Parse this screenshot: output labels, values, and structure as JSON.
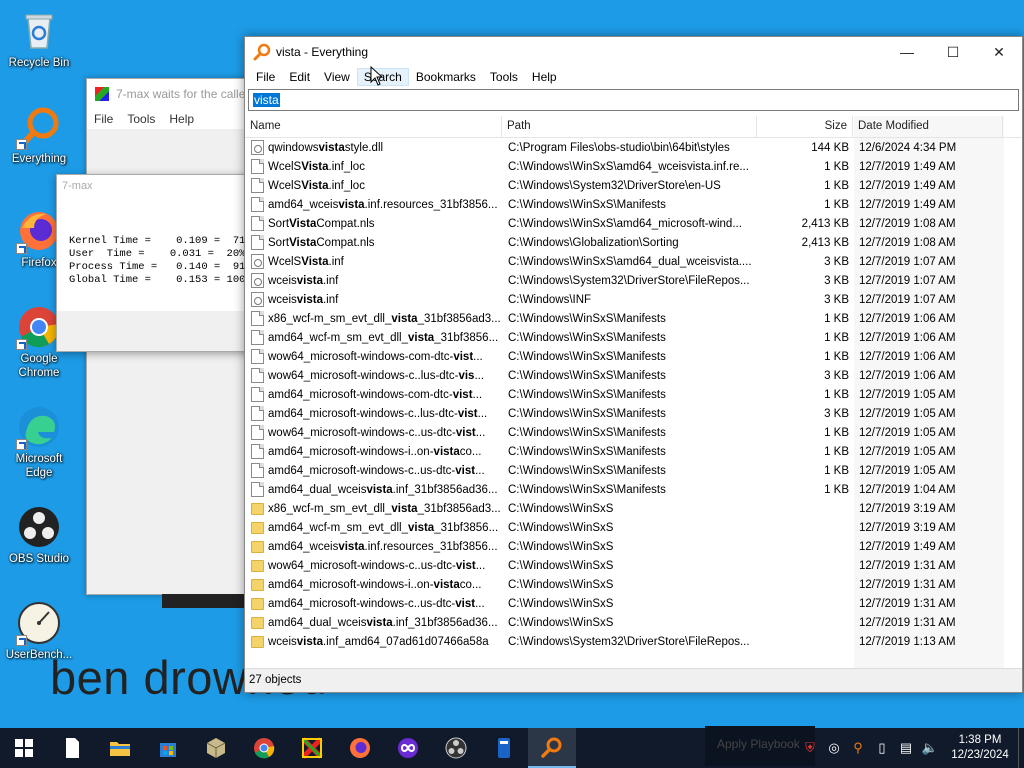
{
  "desktop": {
    "icons": [
      {
        "label": "Recycle Bin"
      },
      {
        "label": "Everything"
      },
      {
        "label": "Firefox"
      },
      {
        "label": "Google Chrome"
      },
      {
        "label": "Microsoft Edge"
      },
      {
        "label": "OBS Studio"
      },
      {
        "label": "UserBench..."
      }
    ],
    "wallpaper_text": "ben drowned"
  },
  "sevenmax_window": {
    "title": "7-max waits for the calle",
    "menu": [
      "File",
      "Tools",
      "Help"
    ]
  },
  "sevenmax_popup": {
    "title": "7-max",
    "stats": "Kernel Time =    0.109 =  71%   C\nUser  Time =    0.031 =  20%\nProcess Time =   0.140 =  91%   V\nGlobal Time =    0.153 = 100%   F"
  },
  "everything": {
    "title": "vista - Everything",
    "menu": [
      "File",
      "Edit",
      "View",
      "Search",
      "Bookmarks",
      "Tools",
      "Help"
    ],
    "search_value": "vista",
    "columns": {
      "name": "Name",
      "path": "Path",
      "size": "Size",
      "date": "Date Modified"
    },
    "rows": [
      {
        "icon": "gear",
        "pre": "qwindows",
        "bold": "vista",
        "post": "style.dll",
        "path": "C:\\Program Files\\obs-studio\\bin\\64bit\\styles",
        "size": "144 KB",
        "date": "12/6/2024 4:34 PM"
      },
      {
        "icon": "file",
        "pre": "WcelS",
        "bold": "Vista",
        "post": ".inf_loc",
        "path": "C:\\Windows\\WinSxS\\amd64_wceisvista.inf.re...",
        "size": "1 KB",
        "date": "12/7/2019 1:49 AM"
      },
      {
        "icon": "file",
        "pre": "WcelS",
        "bold": "Vista",
        "post": ".inf_loc",
        "path": "C:\\Windows\\System32\\DriverStore\\en-US",
        "size": "1 KB",
        "date": "12/7/2019 1:49 AM"
      },
      {
        "icon": "file",
        "pre": "amd64_wceis",
        "bold": "vista",
        "post": ".inf.resources_31bf3856...",
        "path": "C:\\Windows\\WinSxS\\Manifests",
        "size": "1 KB",
        "date": "12/7/2019 1:49 AM"
      },
      {
        "icon": "file",
        "pre": "Sort",
        "bold": "Vista",
        "post": "Compat.nls",
        "path": "C:\\Windows\\WinSxS\\amd64_microsoft-wind...",
        "size": "2,413 KB",
        "date": "12/7/2019 1:08 AM"
      },
      {
        "icon": "file",
        "pre": "Sort",
        "bold": "Vista",
        "post": "Compat.nls",
        "path": "C:\\Windows\\Globalization\\Sorting",
        "size": "2,413 KB",
        "date": "12/7/2019 1:08 AM"
      },
      {
        "icon": "gear",
        "pre": "WcelS",
        "bold": "Vista",
        "post": ".inf",
        "path": "C:\\Windows\\WinSxS\\amd64_dual_wceisvista....",
        "size": "3 KB",
        "date": "12/7/2019 1:07 AM"
      },
      {
        "icon": "gear",
        "pre": "wceis",
        "bold": "vista",
        "post": ".inf",
        "path": "C:\\Windows\\System32\\DriverStore\\FileRepos...",
        "size": "3 KB",
        "date": "12/7/2019 1:07 AM"
      },
      {
        "icon": "gear",
        "pre": "wceis",
        "bold": "vista",
        "post": ".inf",
        "path": "C:\\Windows\\INF",
        "size": "3 KB",
        "date": "12/7/2019 1:07 AM"
      },
      {
        "icon": "file",
        "pre": "x86_wcf-m_sm_evt_dll_",
        "bold": "vista",
        "post": "_31bf3856ad3...",
        "path": "C:\\Windows\\WinSxS\\Manifests",
        "size": "1 KB",
        "date": "12/7/2019 1:06 AM"
      },
      {
        "icon": "file",
        "pre": "amd64_wcf-m_sm_evt_dll_",
        "bold": "vista",
        "post": "_31bf3856...",
        "path": "C:\\Windows\\WinSxS\\Manifests",
        "size": "1 KB",
        "date": "12/7/2019 1:06 AM"
      },
      {
        "icon": "file",
        "pre": "wow64_microsoft-windows-com-dtc-",
        "bold": "vist",
        "post": "...",
        "path": "C:\\Windows\\WinSxS\\Manifests",
        "size": "1 KB",
        "date": "12/7/2019 1:06 AM"
      },
      {
        "icon": "file",
        "pre": "wow64_microsoft-windows-c..lus-dtc-",
        "bold": "vis",
        "post": "...",
        "path": "C:\\Windows\\WinSxS\\Manifests",
        "size": "3 KB",
        "date": "12/7/2019 1:06 AM"
      },
      {
        "icon": "file",
        "pre": "amd64_microsoft-windows-com-dtc-",
        "bold": "vist",
        "post": "...",
        "path": "C:\\Windows\\WinSxS\\Manifests",
        "size": "1 KB",
        "date": "12/7/2019 1:05 AM"
      },
      {
        "icon": "file",
        "pre": "amd64_microsoft-windows-c..lus-dtc-",
        "bold": "vist",
        "post": "...",
        "path": "C:\\Windows\\WinSxS\\Manifests",
        "size": "3 KB",
        "date": "12/7/2019 1:05 AM"
      },
      {
        "icon": "file",
        "pre": "wow64_microsoft-windows-c..us-dtc-",
        "bold": "vist",
        "post": "...",
        "path": "C:\\Windows\\WinSxS\\Manifests",
        "size": "1 KB",
        "date": "12/7/2019 1:05 AM"
      },
      {
        "icon": "file",
        "pre": "amd64_microsoft-windows-i..on-",
        "bold": "vista",
        "post": "co...",
        "path": "C:\\Windows\\WinSxS\\Manifests",
        "size": "1 KB",
        "date": "12/7/2019 1:05 AM"
      },
      {
        "icon": "file",
        "pre": "amd64_microsoft-windows-c..us-dtc-",
        "bold": "vist",
        "post": "...",
        "path": "C:\\Windows\\WinSxS\\Manifests",
        "size": "1 KB",
        "date": "12/7/2019 1:05 AM"
      },
      {
        "icon": "file",
        "pre": "amd64_dual_wceis",
        "bold": "vista",
        "post": ".inf_31bf3856ad36...",
        "path": "C:\\Windows\\WinSxS\\Manifests",
        "size": "1 KB",
        "date": "12/7/2019 1:04 AM"
      },
      {
        "icon": "folder",
        "pre": "x86_wcf-m_sm_evt_dll_",
        "bold": "vista",
        "post": "_31bf3856ad3...",
        "path": "C:\\Windows\\WinSxS",
        "size": "",
        "date": "12/7/2019 3:19 AM"
      },
      {
        "icon": "folder",
        "pre": "amd64_wcf-m_sm_evt_dll_",
        "bold": "vista",
        "post": "_31bf3856...",
        "path": "C:\\Windows\\WinSxS",
        "size": "",
        "date": "12/7/2019 3:19 AM"
      },
      {
        "icon": "folder",
        "pre": "amd64_wceis",
        "bold": "vista",
        "post": ".inf.resources_31bf3856...",
        "path": "C:\\Windows\\WinSxS",
        "size": "",
        "date": "12/7/2019 1:49 AM"
      },
      {
        "icon": "folder",
        "pre": "wow64_microsoft-windows-c..us-dtc-",
        "bold": "vist",
        "post": "...",
        "path": "C:\\Windows\\WinSxS",
        "size": "",
        "date": "12/7/2019 1:31 AM"
      },
      {
        "icon": "folder",
        "pre": "amd64_microsoft-windows-i..on-",
        "bold": "vista",
        "post": "co...",
        "path": "C:\\Windows\\WinSxS",
        "size": "",
        "date": "12/7/2019 1:31 AM"
      },
      {
        "icon": "folder",
        "pre": "amd64_microsoft-windows-c..us-dtc-",
        "bold": "vist",
        "post": "...",
        "path": "C:\\Windows\\WinSxS",
        "size": "",
        "date": "12/7/2019 1:31 AM"
      },
      {
        "icon": "folder",
        "pre": "amd64_dual_wceis",
        "bold": "vista",
        "post": ".inf_31bf3856ad36...",
        "path": "C:\\Windows\\WinSxS",
        "size": "",
        "date": "12/7/2019 1:31 AM"
      },
      {
        "icon": "folder",
        "pre": "wceis",
        "bold": "vista",
        "post": ".inf_amd64_07ad61d07466a58a",
        "path": "C:\\Windows\\System32\\DriverStore\\FileRepos...",
        "size": "",
        "date": "12/7/2019 1:13 AM"
      }
    ],
    "status": "27 objects"
  },
  "taskbar": {
    "apps": [
      "start",
      "notepad",
      "file-explorer",
      "microsoft-store",
      "virtualbox",
      "chrome",
      "7-max",
      "firefox",
      "obs-replay",
      "obs-studio",
      "remote-tool",
      "everything"
    ],
    "toast_text": "Apply Playbook",
    "time": "1:38 PM",
    "date": "12/23/2024"
  },
  "colors": {
    "desktop": "#1d9be6",
    "taskbar": "#101a2a",
    "selection": "#0078d7",
    "everything_orange": "#f07a10"
  }
}
